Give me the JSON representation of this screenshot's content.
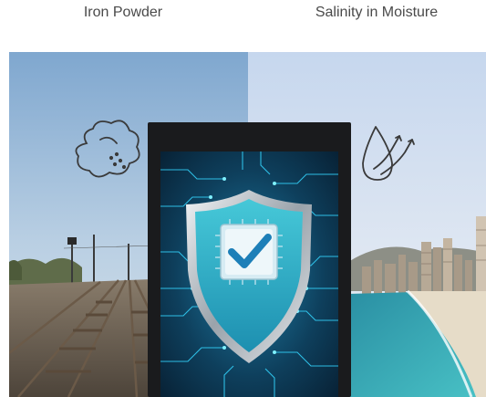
{
  "labels": {
    "left": "Iron Powder",
    "right": "Salinity in Moisture"
  },
  "icons": {
    "left": "dust-cloud-icon",
    "right": "water-drop-airflow-icon",
    "center": "shield-checkmark-icon"
  },
  "colors": {
    "icon_stroke": "#3a3a3a",
    "shield_fill": "#2fb4c7",
    "check": "#1d7fb8",
    "screen_glow": "#34d6ff"
  }
}
